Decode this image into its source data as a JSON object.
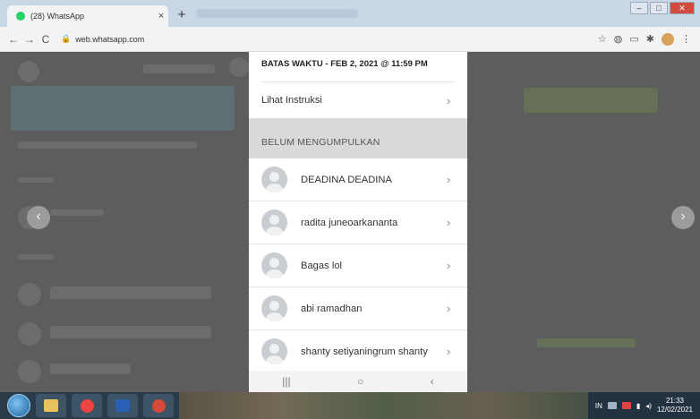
{
  "browser": {
    "tab_title": "(28) WhatsApp",
    "tab_close": "×",
    "new_tab": "+",
    "back": "←",
    "forward": "→",
    "reload": "C",
    "url": "web.whatsapp.com",
    "star": "☆",
    "window_minimize": "–",
    "window_maximize": "□",
    "window_close": "✕"
  },
  "panel": {
    "deadline": "BATAS WAKTU - FEB 2, 2021 @ 11:59 PM",
    "instructions_label": "Lihat Instruksi",
    "section_title": "BELUM MENGUMPULKAN",
    "students": [
      {
        "name": "DEADINA DEADINA"
      },
      {
        "name": "radita juneoarkananta"
      },
      {
        "name": "Bagas lol"
      },
      {
        "name": "abi ramadhan"
      },
      {
        "name": "shanty setiyaningrum shanty"
      }
    ],
    "chevron": "›"
  },
  "phone_nav": {
    "recent": "|||",
    "home": "○",
    "back": "‹"
  },
  "slider": {
    "prev": "‹",
    "next": "›"
  },
  "taskbar": {
    "time": "21:33",
    "date": "12/02/2021",
    "lang": "IN"
  },
  "icons": {
    "favicon": "whatsapp-icon",
    "lock": "lock-icon",
    "start": "windows-start-icon"
  }
}
